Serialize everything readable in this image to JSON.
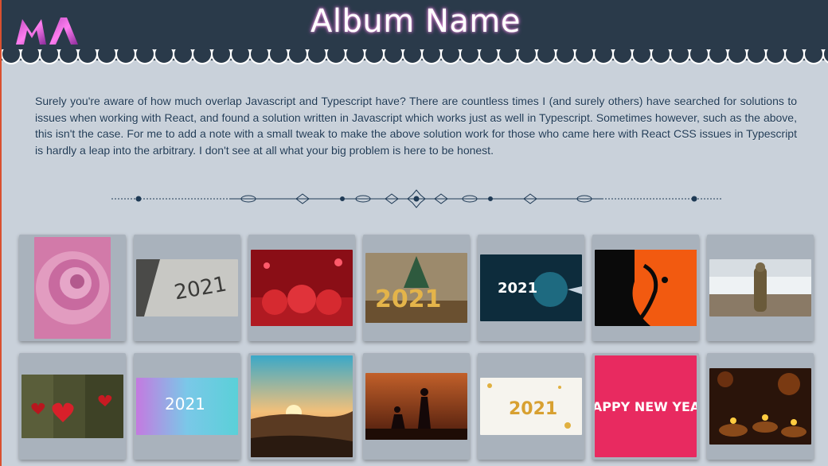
{
  "page": {
    "title": "Album Name",
    "logo_icon": "ma-monogram-logo",
    "intro_text": "Surely you're aware of how much overlap Javascript and Typescript have? There are countless times I (and surely others) have searched for solutions to issues when working with React, and found a solution written in Javascript which works just as well in Typescript. Sometimes however, such as the above, this isn't the case. For me to add a note with a small tweak to make the above solution work for those who came here with React CSS issues in Typescript is hardly a leap into the arbitrary. I don't see at all what your big problem is here to be honest.",
    "divider_icon": "ornamental-divider"
  },
  "colors": {
    "header_bg": "#2a3a4a",
    "page_bg": "#c9d1da",
    "card_bg": "#a9b2bc",
    "title_glow": "#c55bc0",
    "text": "#1f3a55"
  },
  "gallery": {
    "photos": [
      {
        "subject": "pink rose"
      },
      {
        "subject": "2021 written in snow",
        "text": "2021"
      },
      {
        "subject": "red roses with hearts"
      },
      {
        "subject": "gold 2021 with christmas tree",
        "text": "2021"
      },
      {
        "subject": "2021 digital hand",
        "text": "2021"
      },
      {
        "subject": "orange hanuman art"
      },
      {
        "subject": "statue on beach"
      },
      {
        "subject": "red hearts on wood"
      },
      {
        "subject": "2021 pastel glitter",
        "text": "2021"
      },
      {
        "subject": "sunset over hills"
      },
      {
        "subject": "couple silhouette at sunset"
      },
      {
        "subject": "gold 2021 confetti",
        "text": "2021"
      },
      {
        "subject": "happy new year pink",
        "text": "HAPPY NEW YEAR"
      },
      {
        "subject": "diwali diya lamps"
      }
    ]
  }
}
